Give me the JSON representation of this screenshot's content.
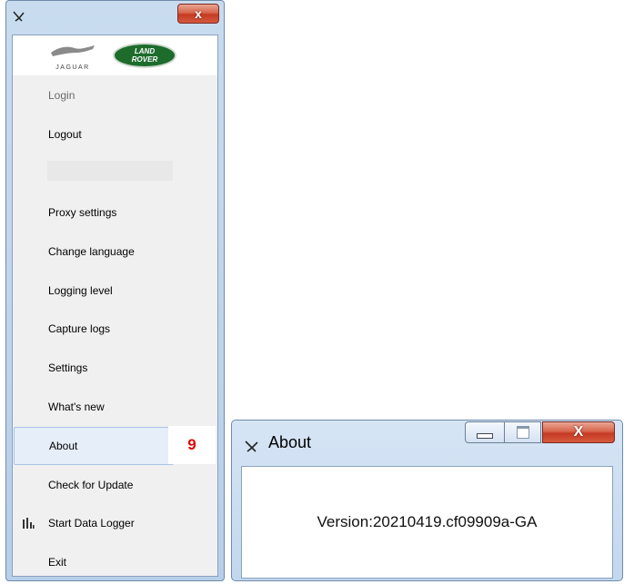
{
  "menu_window": {
    "close_label": "x",
    "logos": {
      "jaguar": "JAGUAR",
      "landrover_line1": "LAND",
      "landrover_line2": "ROVER"
    },
    "items": [
      {
        "label": "Login",
        "state": "disabled"
      },
      {
        "label": "Logout"
      },
      {
        "label": "Proxy settings"
      },
      {
        "label": "Change language"
      },
      {
        "label": "Logging level"
      },
      {
        "label": "Capture logs"
      },
      {
        "label": "Settings"
      },
      {
        "label": "What's new"
      },
      {
        "label": "About",
        "state": "selected"
      },
      {
        "label": "Check for Update"
      },
      {
        "label": "Start Data Logger",
        "icon": "bar-chart-icon"
      },
      {
        "label": "Exit"
      }
    ],
    "step_badge": "9"
  },
  "about_window": {
    "title": "About",
    "close_label": "X",
    "version_text": "Version:20210419.cf09909a-GA"
  },
  "colors": {
    "step_badge": "#e30000",
    "landrover_green": "#1d6c2c",
    "close_red": "#c63a24"
  }
}
